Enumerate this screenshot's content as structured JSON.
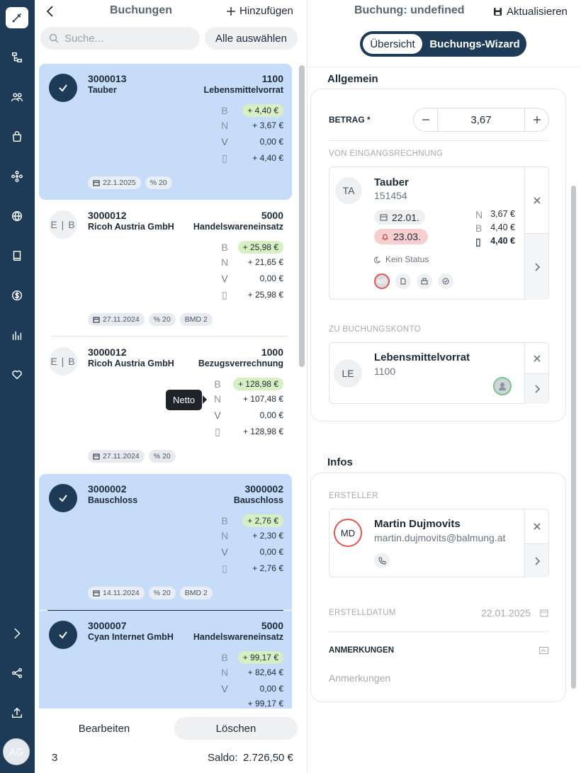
{
  "nav": {
    "avatar": "AG"
  },
  "list": {
    "title": "Buchungen",
    "add_label": "Hinzufügen",
    "search_placeholder": "Suche...",
    "select_all": "Alle auswählen",
    "items": [
      {
        "number": "3000013",
        "name": "Tauber",
        "account": "1100",
        "account_name": "Lebensmittelvorrat",
        "selected": true,
        "b": "+ 4,40 €",
        "n": "+ 3,67 €",
        "v": "0,00 €",
        "o": "+ 4,40 €",
        "date": "22.1.2025",
        "tax": "% 20",
        "bmd": ""
      },
      {
        "number": "3000012",
        "name": "Ricoh Austria GmbH",
        "account": "5000",
        "account_name": "Handelswareneinsatz",
        "selected": false,
        "badge": "E | B",
        "b": "+ 25,98 €",
        "n": "+ 21,65 €",
        "v": "0,00 €",
        "o": "+ 25,98 €",
        "date": "27.11.2024",
        "tax": "% 20",
        "bmd": "BMD 2"
      },
      {
        "number": "3000012",
        "name": "Ricoh Austria GmbH",
        "account": "1000",
        "account_name": "Bezugsverrechnung",
        "selected": false,
        "badge": "E | B",
        "b": "+ 128,98 €",
        "n": "+ 107,48 €",
        "v": "0,00 €",
        "o": "+ 128,98 €",
        "date": "27.11.2024",
        "tax": "% 20",
        "bmd": ""
      },
      {
        "number": "3000002",
        "name": "Bauschloss",
        "account": "3000002",
        "account_name": "Bauschloss",
        "selected": true,
        "b": "+ 2,76 €",
        "n": "+ 2,30 €",
        "v": "0,00 €",
        "o": "+ 2,76 €",
        "date": "14.11.2024",
        "tax": "% 20",
        "bmd": "BMD 2"
      },
      {
        "number": "3000007",
        "name": "Cyan Internet GmbH",
        "account": "5000",
        "account_name": "Handelswareneinsatz",
        "selected": true,
        "b": "+ 99,17 €",
        "n": "+ 82,64 €",
        "v": "0,00 €",
        "o": "+ 99,17 €"
      }
    ],
    "letters": {
      "b": "B",
      "n": "N",
      "v": "V"
    },
    "tooltip": "Netto",
    "edit_button": "Bearbeiten",
    "delete_button": "Löschen",
    "count": "3",
    "saldo_label": "Saldo:",
    "saldo_value": "2.726,50 €"
  },
  "detail": {
    "title": "Buchung: undefined",
    "refresh": "Aktualisieren",
    "tabs": [
      "Übersicht",
      "Buchungs-Wizard"
    ],
    "active_tab": "Übersicht",
    "general": {
      "heading": "Allgemein",
      "amount_label": "BETRAG *",
      "amount_value": "3,67",
      "from_label": "VON EINGANGSRECHNUNG",
      "invoice": {
        "initials": "TA",
        "name": "Tauber",
        "id": "151454",
        "date1": "22.01.",
        "date2": "23.03.",
        "status": "Kein Status",
        "n_value": "3,67 €",
        "b_value": "4,40 €",
        "o_value": "4,40 €",
        "user": "MD"
      },
      "to_label": "ZU BUCHUNGSKONTO",
      "account": {
        "initials": "LE",
        "name": "Lebensmittelvorrat",
        "number": "1100"
      }
    },
    "infos": {
      "heading": "Infos",
      "creator_label": "ERSTELLER",
      "creator": {
        "initials": "MD",
        "name": "Martin Dujmovits",
        "email": "martin.dujmovits@balmung.at"
      },
      "created_label": "ERSTELLDATUM",
      "created_value": "22.01.2025",
      "notes_label": "ANMERKUNGEN",
      "notes_placeholder": "Anmerkungen"
    }
  }
}
